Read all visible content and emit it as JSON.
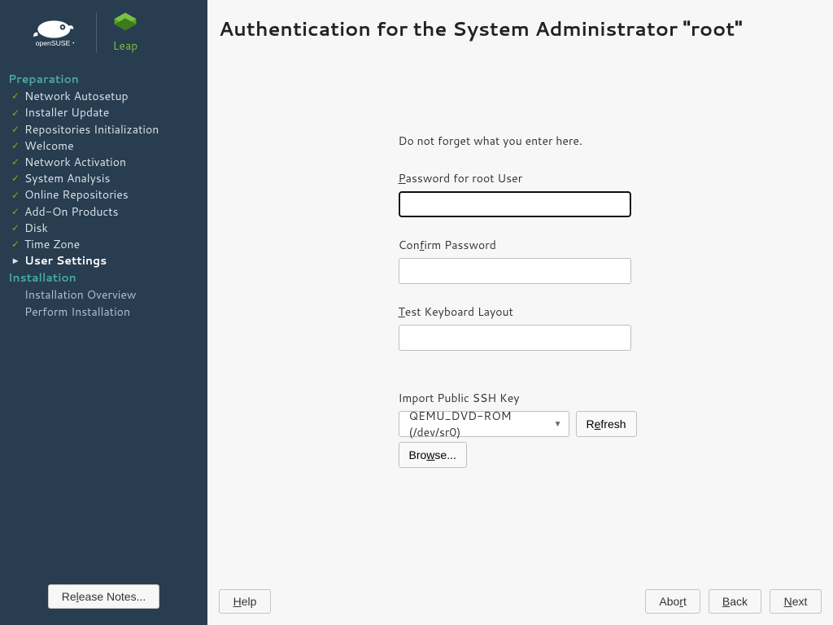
{
  "brand": {
    "distro": "openSUSE",
    "variant": "Leap"
  },
  "sidebar": {
    "sections": [
      {
        "title": "Preparation",
        "items": [
          {
            "label": "Network Autosetup",
            "state": "done"
          },
          {
            "label": "Installer Update",
            "state": "done"
          },
          {
            "label": "Repositories Initialization",
            "state": "done"
          },
          {
            "label": "Welcome",
            "state": "done"
          },
          {
            "label": "Network Activation",
            "state": "done"
          },
          {
            "label": "System Analysis",
            "state": "done"
          },
          {
            "label": "Online Repositories",
            "state": "done"
          },
          {
            "label": "Add-On Products",
            "state": "done"
          },
          {
            "label": "Disk",
            "state": "done"
          },
          {
            "label": "Time Zone",
            "state": "done"
          },
          {
            "label": "User Settings",
            "state": "current"
          }
        ]
      },
      {
        "title": "Installation",
        "items": [
          {
            "label": "Installation Overview",
            "state": "pending"
          },
          {
            "label": "Perform Installation",
            "state": "pending"
          }
        ]
      }
    ],
    "release_notes": "Release Notes..."
  },
  "page": {
    "title": "Authentication for the System Administrator \"root\"",
    "hint": "Do not forget what you enter here.",
    "password_label_pre": "P",
    "password_label_post": "assword for root User",
    "confirm_label_pre": "Con",
    "confirm_label_mid": "f",
    "confirm_label_post": "irm Password",
    "test_label_pre": "T",
    "test_label_post": "est Keyboard Layout",
    "ssh_label": "Import Public SSH Key",
    "ssh_selected": "QEMU_DVD-ROM (/dev/sr0)",
    "refresh_pre": "R",
    "refresh_mid": "e",
    "refresh_post": "fresh",
    "browse_pre": "Bro",
    "browse_mid": "w",
    "browse_post": "se...",
    "password_value": "",
    "confirm_value": "",
    "test_value": ""
  },
  "footer": {
    "help_pre": "H",
    "help_mid": "e",
    "help_post": "lp",
    "abort_pre": "Abo",
    "abort_mid": "r",
    "abort_post": "t",
    "back_pre": "B",
    "back_post": "ack",
    "next_pre": "N",
    "next_post": "ext",
    "rel_pre": "Re",
    "rel_mid": "l",
    "rel_post": "ease Notes..."
  }
}
